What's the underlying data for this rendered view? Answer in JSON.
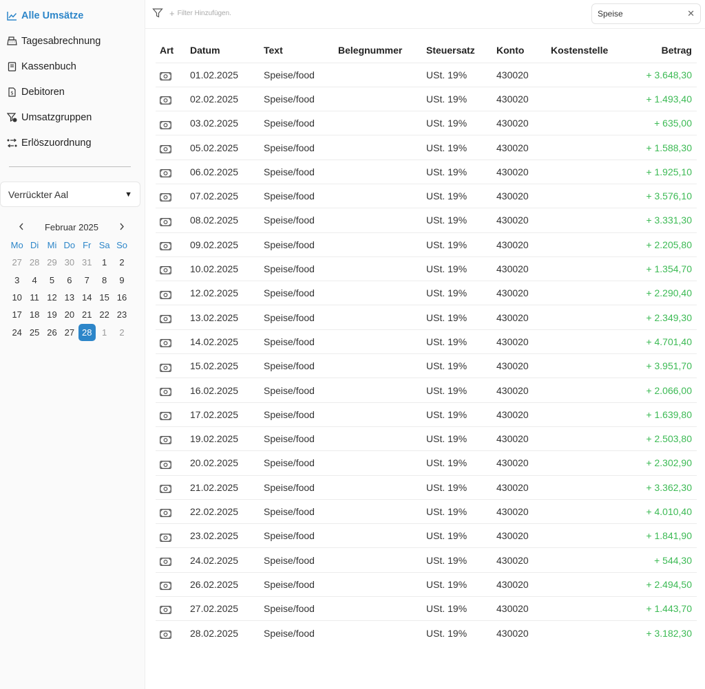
{
  "sidebar": {
    "nav": [
      {
        "label": "Alle Umsätze",
        "icon": "chart-line-icon"
      },
      {
        "label": "Tagesabrechnung",
        "icon": "cash-register-icon"
      },
      {
        "label": "Kassenbuch",
        "icon": "book-icon"
      },
      {
        "label": "Debitoren",
        "icon": "invoice-icon"
      },
      {
        "label": "Umsatzgruppen",
        "icon": "filter-settings-icon"
      },
      {
        "label": "Erlöszuordnung",
        "icon": "swap-icon"
      }
    ],
    "location_select": {
      "value": "Verrückter Aal"
    },
    "calendar": {
      "title": "Februar 2025",
      "weekdays": [
        "Mo",
        "Di",
        "Mi",
        "Do",
        "Fr",
        "Sa",
        "So"
      ],
      "weeks": [
        [
          "27",
          "28",
          "29",
          "30",
          "31",
          "1",
          "2"
        ],
        [
          "3",
          "4",
          "5",
          "6",
          "7",
          "8",
          "9"
        ],
        [
          "10",
          "11",
          "12",
          "13",
          "14",
          "15",
          "16"
        ],
        [
          "17",
          "18",
          "19",
          "20",
          "21",
          "22",
          "23"
        ],
        [
          "24",
          "25",
          "26",
          "27",
          "28",
          "1",
          "2"
        ]
      ],
      "selected": "28"
    }
  },
  "toolbar": {
    "add_filter_label": "Filter Hinzufügen.",
    "search_value": "Speise"
  },
  "table": {
    "headers": {
      "art": "Art",
      "datum": "Datum",
      "text": "Text",
      "beleg": "Belegnummer",
      "steuer": "Steuersatz",
      "konto": "Konto",
      "kst": "Kostenstelle",
      "betrag": "Betrag"
    },
    "rows": [
      {
        "datum": "01.02.2025",
        "text": "Speise/food",
        "beleg": "",
        "steuer": "USt. 19%",
        "konto": "430020",
        "kst": "",
        "betrag": "+ 3.648,30"
      },
      {
        "datum": "02.02.2025",
        "text": "Speise/food",
        "beleg": "",
        "steuer": "USt. 19%",
        "konto": "430020",
        "kst": "",
        "betrag": "+ 1.493,40"
      },
      {
        "datum": "03.02.2025",
        "text": "Speise/food",
        "beleg": "",
        "steuer": "USt. 19%",
        "konto": "430020",
        "kst": "",
        "betrag": "+ 635,00"
      },
      {
        "datum": "05.02.2025",
        "text": "Speise/food",
        "beleg": "",
        "steuer": "USt. 19%",
        "konto": "430020",
        "kst": "",
        "betrag": "+ 1.588,30"
      },
      {
        "datum": "06.02.2025",
        "text": "Speise/food",
        "beleg": "",
        "steuer": "USt. 19%",
        "konto": "430020",
        "kst": "",
        "betrag": "+ 1.925,10"
      },
      {
        "datum": "07.02.2025",
        "text": "Speise/food",
        "beleg": "",
        "steuer": "USt. 19%",
        "konto": "430020",
        "kst": "",
        "betrag": "+ 3.576,10"
      },
      {
        "datum": "08.02.2025",
        "text": "Speise/food",
        "beleg": "",
        "steuer": "USt. 19%",
        "konto": "430020",
        "kst": "",
        "betrag": "+ 3.331,30"
      },
      {
        "datum": "09.02.2025",
        "text": "Speise/food",
        "beleg": "",
        "steuer": "USt. 19%",
        "konto": "430020",
        "kst": "",
        "betrag": "+ 2.205,80"
      },
      {
        "datum": "10.02.2025",
        "text": "Speise/food",
        "beleg": "",
        "steuer": "USt. 19%",
        "konto": "430020",
        "kst": "",
        "betrag": "+ 1.354,70"
      },
      {
        "datum": "12.02.2025",
        "text": "Speise/food",
        "beleg": "",
        "steuer": "USt. 19%",
        "konto": "430020",
        "kst": "",
        "betrag": "+ 2.290,40"
      },
      {
        "datum": "13.02.2025",
        "text": "Speise/food",
        "beleg": "",
        "steuer": "USt. 19%",
        "konto": "430020",
        "kst": "",
        "betrag": "+ 2.349,30"
      },
      {
        "datum": "14.02.2025",
        "text": "Speise/food",
        "beleg": "",
        "steuer": "USt. 19%",
        "konto": "430020",
        "kst": "",
        "betrag": "+ 4.701,40"
      },
      {
        "datum": "15.02.2025",
        "text": "Speise/food",
        "beleg": "",
        "steuer": "USt. 19%",
        "konto": "430020",
        "kst": "",
        "betrag": "+ 3.951,70"
      },
      {
        "datum": "16.02.2025",
        "text": "Speise/food",
        "beleg": "",
        "steuer": "USt. 19%",
        "konto": "430020",
        "kst": "",
        "betrag": "+ 2.066,00"
      },
      {
        "datum": "17.02.2025",
        "text": "Speise/food",
        "beleg": "",
        "steuer": "USt. 19%",
        "konto": "430020",
        "kst": "",
        "betrag": "+ 1.639,80"
      },
      {
        "datum": "19.02.2025",
        "text": "Speise/food",
        "beleg": "",
        "steuer": "USt. 19%",
        "konto": "430020",
        "kst": "",
        "betrag": "+ 2.503,80"
      },
      {
        "datum": "20.02.2025",
        "text": "Speise/food",
        "beleg": "",
        "steuer": "USt. 19%",
        "konto": "430020",
        "kst": "",
        "betrag": "+ 2.302,90"
      },
      {
        "datum": "21.02.2025",
        "text": "Speise/food",
        "beleg": "",
        "steuer": "USt. 19%",
        "konto": "430020",
        "kst": "",
        "betrag": "+ 3.362,30"
      },
      {
        "datum": "22.02.2025",
        "text": "Speise/food",
        "beleg": "",
        "steuer": "USt. 19%",
        "konto": "430020",
        "kst": "",
        "betrag": "+ 4.010,40"
      },
      {
        "datum": "23.02.2025",
        "text": "Speise/food",
        "beleg": "",
        "steuer": "USt. 19%",
        "konto": "430020",
        "kst": "",
        "betrag": "+ 1.841,90"
      },
      {
        "datum": "24.02.2025",
        "text": "Speise/food",
        "beleg": "",
        "steuer": "USt. 19%",
        "konto": "430020",
        "kst": "",
        "betrag": "+ 544,30"
      },
      {
        "datum": "26.02.2025",
        "text": "Speise/food",
        "beleg": "",
        "steuer": "USt. 19%",
        "konto": "430020",
        "kst": "",
        "betrag": "+ 2.494,50"
      },
      {
        "datum": "27.02.2025",
        "text": "Speise/food",
        "beleg": "",
        "steuer": "USt. 19%",
        "konto": "430020",
        "kst": "",
        "betrag": "+ 1.443,70"
      },
      {
        "datum": "28.02.2025",
        "text": "Speise/food",
        "beleg": "",
        "steuer": "USt. 19%",
        "konto": "430020",
        "kst": "",
        "betrag": "+ 3.182,30"
      }
    ]
  },
  "colors": {
    "accent": "#2d86c9",
    "positive": "#3cba54"
  }
}
